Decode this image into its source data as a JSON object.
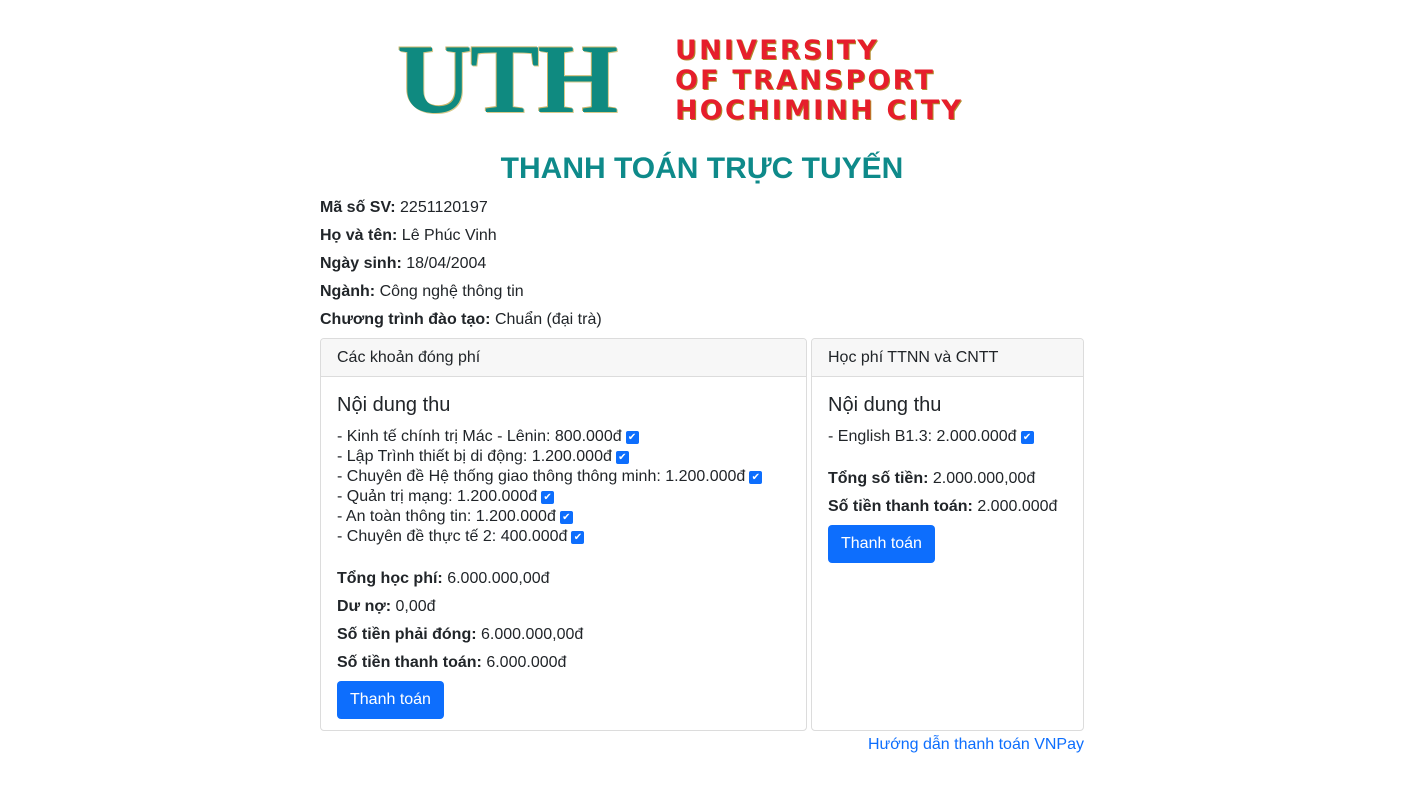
{
  "logo": {
    "mark": "UTH",
    "lines": [
      "UNIVERSITY",
      "OF TRANSPORT",
      "HOCHIMINH CITY"
    ]
  },
  "page_title": "THANH TOÁN TRỰC TUYẾN",
  "student": {
    "id_label": "Mã số SV:",
    "id_value": "2251120197",
    "name_label": "Họ và tên:",
    "name_value": "Lê Phúc Vinh",
    "dob_label": "Ngày sinh:",
    "dob_value": "18/04/2004",
    "major_label": "Ngành:",
    "major_value": "Công nghệ thông tin",
    "program_label": "Chương trình đào tạo:",
    "program_value": "Chuẩn (đại trà)"
  },
  "fees_card": {
    "header": "Các khoản đóng phí",
    "section_title": "Nội dung thu",
    "items": [
      {
        "text": "- Kinh tế chính trị Mác - Lênin: 800.000đ",
        "checked": true
      },
      {
        "text": "- Lập Trình thiết bị di động: 1.200.000đ",
        "checked": true
      },
      {
        "text": "- Chuyên đề Hệ thống giao thông thông minh: 1.200.000đ",
        "checked": true
      },
      {
        "text": "- Quản trị mạng: 1.200.000đ",
        "checked": true
      },
      {
        "text": "- An toàn thông tin: 1.200.000đ",
        "checked": true
      },
      {
        "text": "- Chuyên đề thực tế 2: 400.000đ",
        "checked": true
      }
    ],
    "total_label": "Tổng học phí:",
    "total_value": "6.000.000,00đ",
    "debt_label": "Dư nợ:",
    "debt_value": "0,00đ",
    "due_label": "Số tiền phải đóng:",
    "due_value": "6.000.000,00đ",
    "pay_label": "Số tiền thanh toán:",
    "pay_value": "6.000.000đ",
    "button": "Thanh toán"
  },
  "lang_card": {
    "header": "Học phí TTNN và CNTT",
    "section_title": "Nội dung thu",
    "items": [
      {
        "text": "- English B1.3: 2.000.000đ",
        "checked": true
      }
    ],
    "total_label": "Tổng số tiền:",
    "total_value": "2.000.000,00đ",
    "pay_label": "Số tiền thanh toán:",
    "pay_value": "2.000.000đ",
    "button": "Thanh toán"
  },
  "guide_link": "Hướng dẫn thanh toán VNPay",
  "colors": {
    "accent": "#0d6efd",
    "title": "#0e8a8a",
    "logo_red": "#e61e2b",
    "logo_teal": "#0f8a80"
  }
}
